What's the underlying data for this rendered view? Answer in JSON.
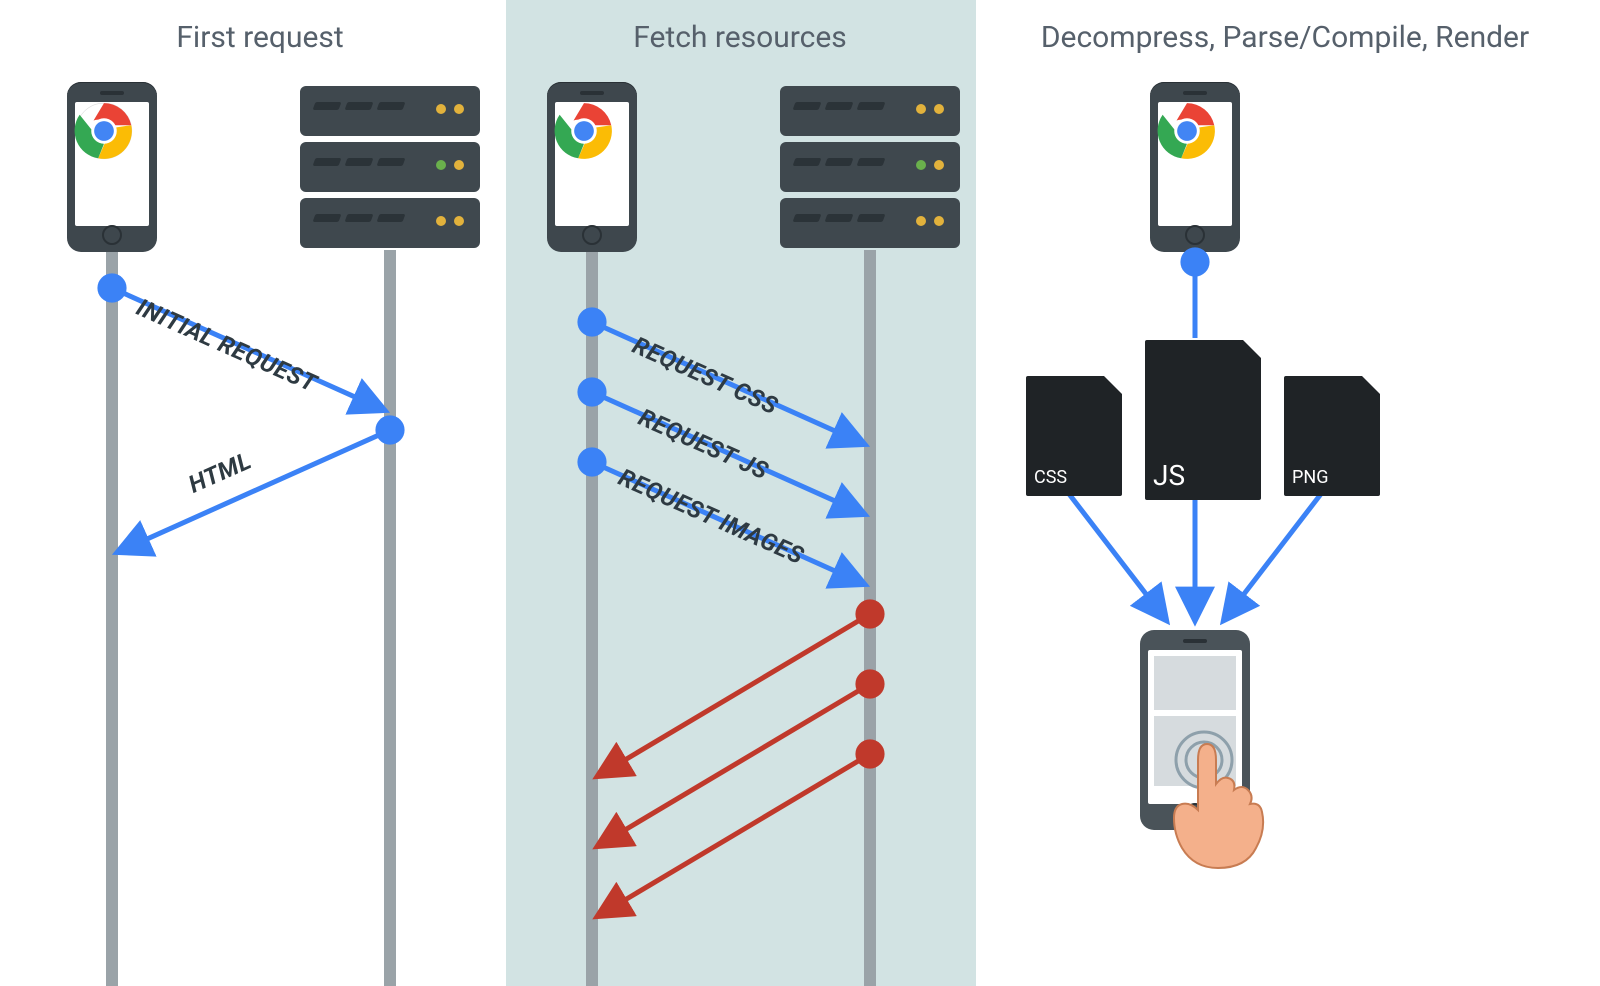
{
  "headings": {
    "first": "First request",
    "fetch": "Fetch resources",
    "render": "Decompress, Parse/Compile, Render"
  },
  "messages": {
    "initial_request": "INITIAL REQUEST",
    "html_response": "HTML",
    "request_css": "REQUEST CSS",
    "request_js": "REQUEST JS",
    "request_images": "REQUEST IMAGES"
  },
  "files": {
    "css": "CSS",
    "js": "JS",
    "png": "PNG"
  },
  "colors": {
    "panel_bg": "#d2e3e3",
    "request_arrow": "#3b82f6",
    "response_arrow": "#c0392b",
    "timeline": "#9aa3a8",
    "server_body": "#3f484e",
    "text": "#4f5a60"
  }
}
